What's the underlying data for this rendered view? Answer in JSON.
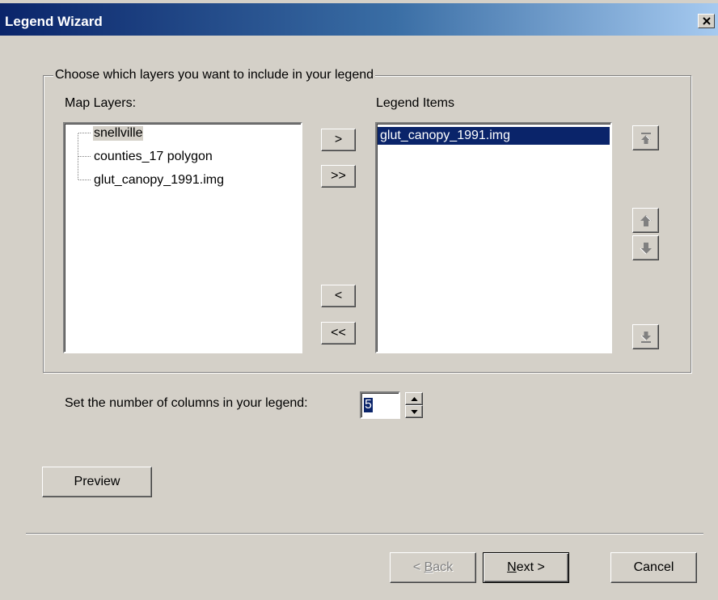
{
  "window": {
    "title": "Legend Wizard"
  },
  "group": {
    "legend": "Choose which layers you want to include in your legend"
  },
  "map_layers": {
    "label": "Map Layers:",
    "items": [
      {
        "label": "snellville",
        "selected": true
      },
      {
        "label": "counties_17 polygon",
        "selected": false
      },
      {
        "label": "glut_canopy_1991.img",
        "selected": false
      }
    ]
  },
  "legend_items": {
    "label": "Legend Items",
    "items": [
      {
        "label": "glut_canopy_1991.img",
        "selected": true
      }
    ]
  },
  "transfer_buttons": {
    "add": ">",
    "add_all": ">>",
    "remove": "<",
    "remove_all": "<<"
  },
  "order_buttons": [
    "move-top-icon",
    "move-up-icon",
    "move-down-icon",
    "move-bottom-icon"
  ],
  "columns": {
    "label": "Set the number of columns in your legend:",
    "value": "5"
  },
  "preview_label": "Preview",
  "footer": {
    "back": {
      "prefix": "< ",
      "mnemonic": "B",
      "rest": "ack",
      "enabled": false
    },
    "next": {
      "mnemonic": "N",
      "rest": "ext >"
    },
    "cancel": "Cancel"
  },
  "colors": {
    "selection": "#0a246a",
    "face": "#d4d0c8",
    "title_start": "#0a246a"
  }
}
